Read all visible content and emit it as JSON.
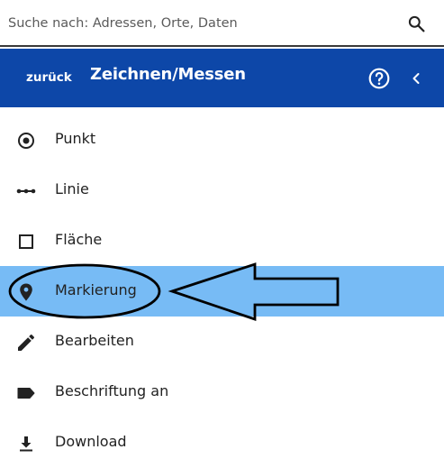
{
  "search": {
    "placeholder": "Suche nach: Adressen, Orte, Daten",
    "icon": "search-icon"
  },
  "header": {
    "back_label": "zurück",
    "title": "Zeichnen/Messen",
    "help_icon": "help-circle-icon",
    "collapse_icon": "chevron-left-icon",
    "background_color": "#0d47a8"
  },
  "menu": {
    "active_color": "#77bbf5",
    "items": [
      {
        "label": "Punkt",
        "icon": "point-radio-icon",
        "active": false
      },
      {
        "label": "Linie",
        "icon": "line-icon",
        "active": false
      },
      {
        "label": "Fläche",
        "icon": "square-outline-icon",
        "active": false
      },
      {
        "label": "Markierung",
        "icon": "map-marker-icon",
        "active": true
      },
      {
        "label": "Bearbeiten",
        "icon": "pencil-icon",
        "active": false
      },
      {
        "label": "Beschriftung an",
        "icon": "label-tag-icon",
        "active": false
      },
      {
        "label": "Download",
        "icon": "download-icon",
        "active": false
      }
    ]
  },
  "annotation": {
    "shapes": [
      "ellipse-highlight",
      "arrow-pointing-left"
    ]
  }
}
